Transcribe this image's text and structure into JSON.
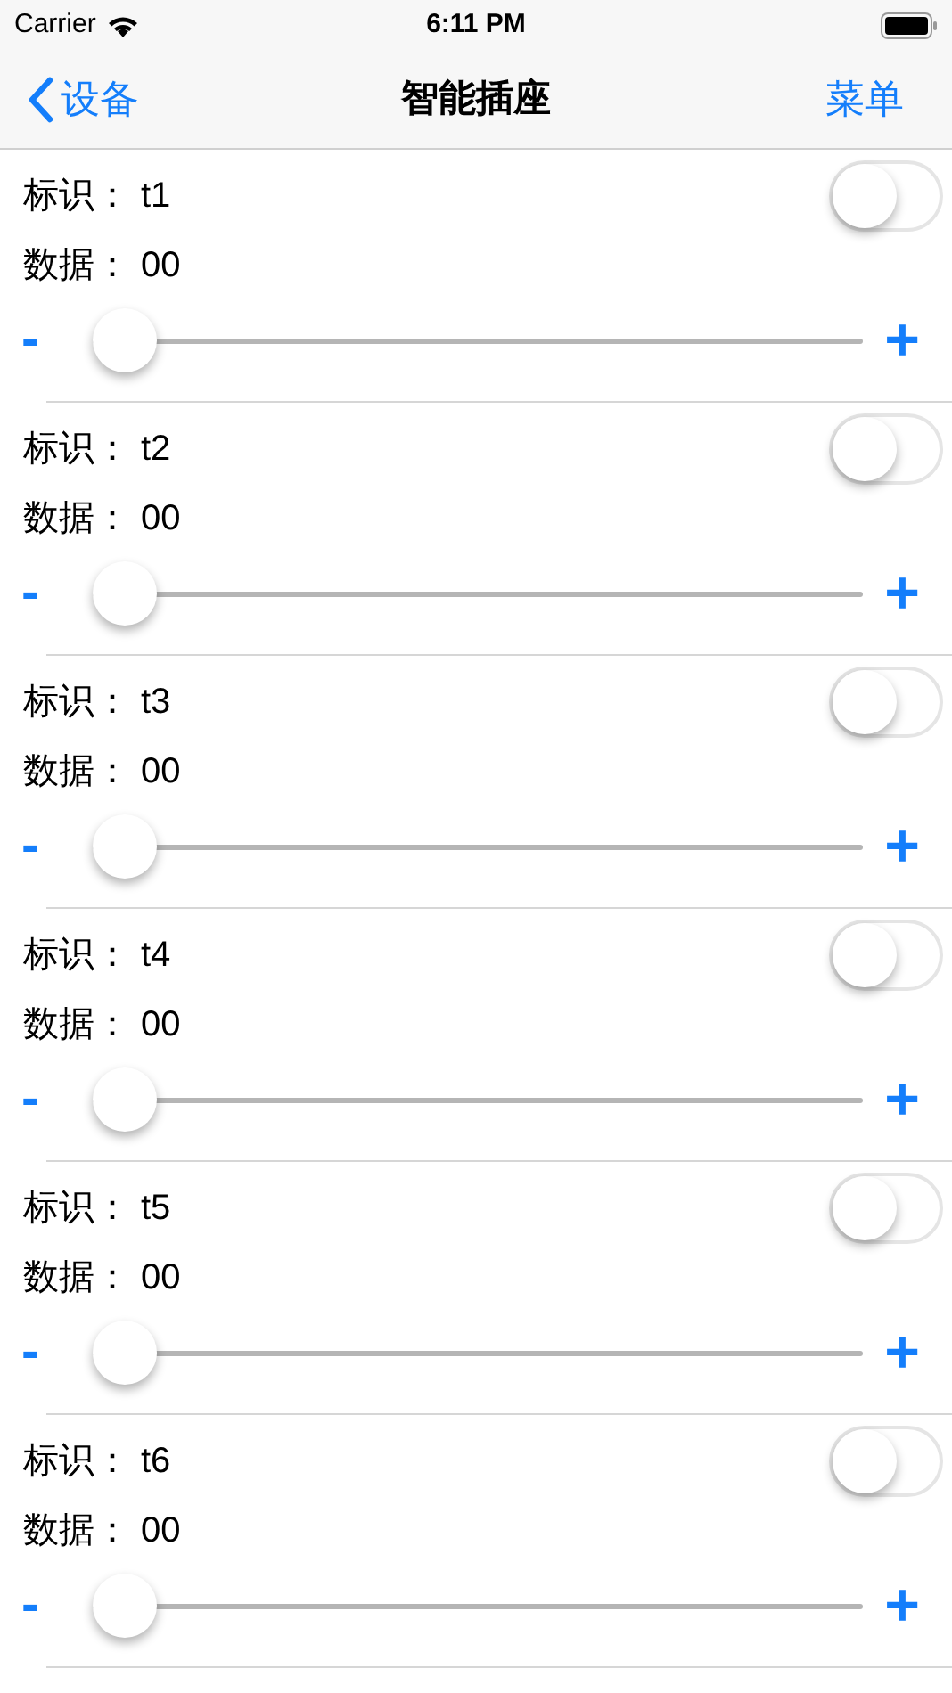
{
  "status_bar": {
    "carrier": "Carrier",
    "time": "6:11 PM"
  },
  "nav": {
    "back": "设备",
    "title": "智能插座",
    "menu": "菜单"
  },
  "rows": [
    {
      "id_label": "标识：",
      "id_value": "t1",
      "data_label": "数据：",
      "data_value": "00",
      "on": false,
      "level": 0,
      "minus": "-",
      "plus": "+"
    },
    {
      "id_label": "标识：",
      "id_value": "t2",
      "data_label": "数据：",
      "data_value": "00",
      "on": false,
      "level": 0,
      "minus": "-",
      "plus": "+"
    },
    {
      "id_label": "标识：",
      "id_value": "t3",
      "data_label": "数据：",
      "data_value": "00",
      "on": false,
      "level": 0,
      "minus": "-",
      "plus": "+"
    },
    {
      "id_label": "标识：",
      "id_value": "t4",
      "data_label": "数据：",
      "data_value": "00",
      "on": false,
      "level": 0,
      "minus": "-",
      "plus": "+"
    },
    {
      "id_label": "标识：",
      "id_value": "t5",
      "data_label": "数据：",
      "data_value": "00",
      "on": false,
      "level": 0,
      "minus": "-",
      "plus": "+"
    },
    {
      "id_label": "标识：",
      "id_value": "t6",
      "data_label": "数据：",
      "data_value": "00",
      "on": false,
      "level": 0,
      "minus": "-",
      "plus": "+"
    }
  ]
}
